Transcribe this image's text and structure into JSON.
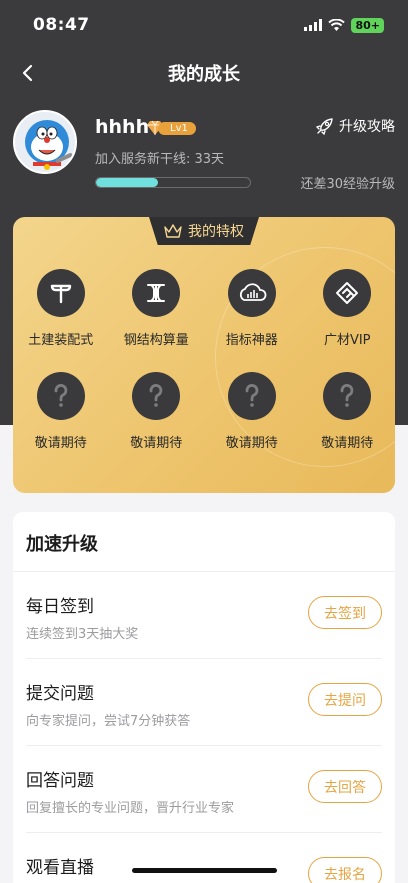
{
  "status": {
    "time": "08:47",
    "battery": "80+"
  },
  "nav": {
    "title": "我的成长",
    "back_icon": "chevron-left-icon"
  },
  "profile": {
    "username": "hhhh",
    "level": "Lv1",
    "join_text": "加入服务新干线: 33天",
    "strategy_label": "升级攻略",
    "upgrade_hint": "还差30经验升级",
    "progress_fraction": 0.4
  },
  "privileges": {
    "title": "我的特权",
    "items": [
      {
        "label": "土建装配式",
        "icon": "t-letter-icon"
      },
      {
        "label": "钢结构算量",
        "icon": "i-beam-icon"
      },
      {
        "label": "指标神器",
        "icon": "cloud-chart-icon"
      },
      {
        "label": "广材VIP",
        "icon": "arrow-diamond-icon"
      },
      {
        "label": "敬请期待",
        "icon": "question-mark-icon"
      },
      {
        "label": "敬请期待",
        "icon": "question-mark-icon"
      },
      {
        "label": "敬请期待",
        "icon": "question-mark-icon"
      },
      {
        "label": "敬请期待",
        "icon": "question-mark-icon"
      }
    ]
  },
  "speed_up": {
    "title": "加速升级",
    "tasks": [
      {
        "name": "每日签到",
        "desc": "连续签到3天抽大奖",
        "button": "去签到"
      },
      {
        "name": "提交问题",
        "desc": "向专家提问，尝试7分钟获答",
        "button": "去提问"
      },
      {
        "name": "回答问题",
        "desc": "回复擅长的专业问题，晋升行业专家",
        "button": "去回答"
      },
      {
        "name": "观看直播",
        "desc": "",
        "button": "去报名"
      }
    ]
  },
  "colors": {
    "accent": "#e7a443",
    "progress": "#6fe0dd",
    "dark_bg": "#3b3b3d",
    "gold": "#eec56e"
  }
}
